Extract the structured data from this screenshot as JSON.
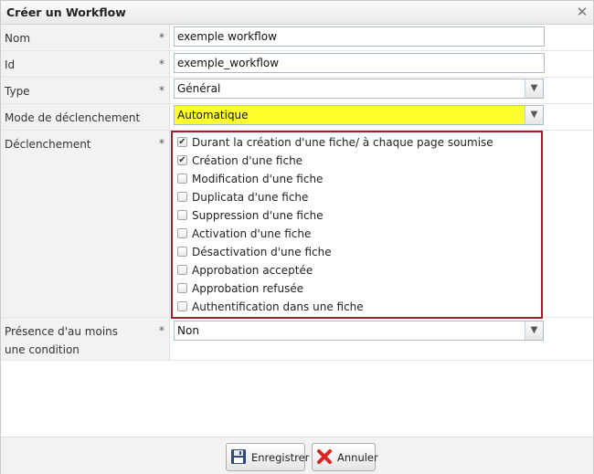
{
  "window": {
    "title": "Créer un Workflow"
  },
  "fields": {
    "nom": {
      "label": "Nom",
      "required": "*",
      "value": "exemple workflow"
    },
    "id": {
      "label": "Id",
      "required": "*",
      "value": "exemple_workflow"
    },
    "type": {
      "label": "Type",
      "required": "*",
      "value": "Général"
    },
    "mode": {
      "label": "Mode de déclenchement",
      "value": "Automatique",
      "highlight_color": "#ffff2e"
    },
    "declenchement": {
      "label": "Déclenchement",
      "required": "*",
      "options": [
        {
          "label": "Durant la création d'une fiche/ à chaque page soumise",
          "checked": true
        },
        {
          "label": "Création d'une fiche",
          "checked": true
        },
        {
          "label": "Modification d'une fiche",
          "checked": false
        },
        {
          "label": "Duplicata d'une fiche",
          "checked": false
        },
        {
          "label": "Suppression d'une fiche",
          "checked": false
        },
        {
          "label": "Activation d'une fiche",
          "checked": false
        },
        {
          "label": "Désactivation d'une fiche",
          "checked": false
        },
        {
          "label": "Approbation acceptée",
          "checked": false
        },
        {
          "label": "Approbation refusée",
          "checked": false
        },
        {
          "label": "Authentification dans une fiche",
          "checked": false
        }
      ],
      "border_color": "#a0202c"
    },
    "presence": {
      "label": "Présence d'au moins une condition",
      "required": "*",
      "value": "Non"
    }
  },
  "buttons": {
    "save": {
      "label": "Enregistrer",
      "icon": "floppy-disk-icon"
    },
    "cancel": {
      "label": "Annuler",
      "icon": "red-x-icon"
    }
  },
  "colors": {
    "label_bg": "#f2f2f2",
    "input_border": "#aeb9c6",
    "cancel_icon": "#d9261c"
  }
}
